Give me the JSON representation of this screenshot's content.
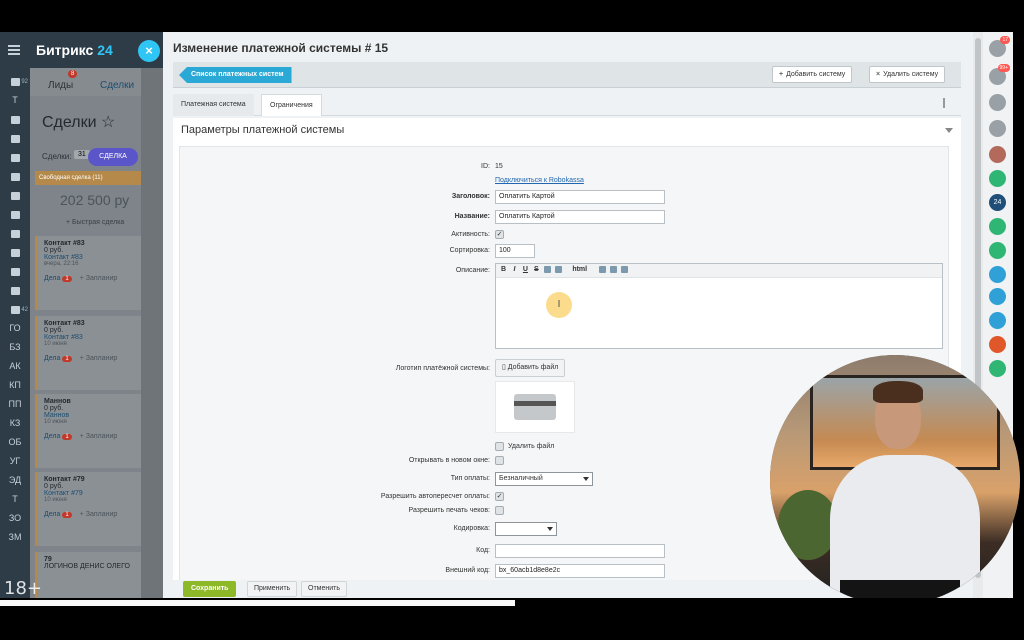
{
  "app": {
    "brand_name": "Битрикс",
    "brand_num": "24"
  },
  "leftnav": {
    "items": [
      {
        "label": "",
        "badge": "92"
      },
      {
        "label": "Т",
        "badge": ""
      },
      {
        "label": "",
        "badge": ""
      },
      {
        "label": "",
        "badge": ""
      },
      {
        "label": "",
        "badge": ""
      },
      {
        "label": "",
        "badge": ""
      },
      {
        "label": "",
        "badge": ""
      },
      {
        "label": "",
        "badge": ""
      },
      {
        "label": "",
        "badge": ""
      },
      {
        "label": "",
        "badge": ""
      },
      {
        "label": "",
        "badge": ""
      },
      {
        "label": "",
        "badge": ""
      },
      {
        "label": "",
        "badge": "42"
      },
      {
        "label": "ГО",
        "badge": ""
      },
      {
        "label": "БЗ",
        "badge": ""
      },
      {
        "label": "АК",
        "badge": ""
      },
      {
        "label": "КП",
        "badge": ""
      },
      {
        "label": "ПП",
        "badge": ""
      },
      {
        "label": "КЗ",
        "badge": ""
      },
      {
        "label": "ОБ",
        "badge": ""
      },
      {
        "label": "УГ",
        "badge": ""
      },
      {
        "label": "ЭД",
        "badge": ""
      },
      {
        "label": "Т",
        "badge": ""
      },
      {
        "label": "ЗО",
        "badge": ""
      },
      {
        "label": "ЗМ",
        "badge": ""
      }
    ]
  },
  "crm": {
    "tab_leads": "Лиды",
    "tab_leads_badge": "8",
    "tab_deals": "Сделки",
    "title": "Сделки ☆",
    "deals_label": "Сделки:",
    "deals_count": "31",
    "deal_button": "СДЕЛКА",
    "stage": "Свободная сделка (11)",
    "sum": "202 500 ру",
    "quick": "+ Быстрая сделка",
    "cards": [
      {
        "title": "Контакт #83",
        "price": "0 руб.",
        "link": "Контакт #83",
        "date": "вчера, 22:16",
        "deal": "Дела",
        "badge": "1",
        "plan": "+ Запланир"
      },
      {
        "title": "Контакт #83",
        "price": "0 руб.",
        "link": "Контакт #83",
        "date": "10 июня",
        "deal": "Дела",
        "badge": "1",
        "plan": "+ Запланир"
      },
      {
        "title": "Маннов",
        "price": "0 руб.",
        "link": "Маннов",
        "date": "10 июня",
        "deal": "Дела",
        "badge": "1",
        "plan": "+ Запланир"
      },
      {
        "title": "Контакт #79",
        "price": "0 руб.",
        "link": "Контакт #79",
        "date": "10 июня",
        "deal": "Дела",
        "badge": "1",
        "plan": "+ Запланир"
      },
      {
        "title": "79",
        "price": "ЛОГИНОВ ДЕНИС ОЛЕГО",
        "link": "",
        "date": "",
        "deal": "",
        "badge": "",
        "plan": ""
      }
    ]
  },
  "slider": {
    "title": "Изменение платежной системы # 15",
    "back_button": "Список платежных систем",
    "add_button": "Добавить систему",
    "delete_button": "Удалить систему",
    "tabs": [
      "Платежная система",
      "Ограничения"
    ],
    "section_title": "Параметры платежной системы",
    "fields": {
      "id_label": "ID:",
      "id_value": "15",
      "robokassa_link": "Подключиться к Robokassa",
      "header_label": "Заголовок:",
      "header_value": "Оплатить Картой",
      "name_label": "Название:",
      "name_value": "Оплатить Картой",
      "active_label": "Активность:",
      "sort_label": "Сортировка:",
      "sort_value": "100",
      "desc_label": "Описание:",
      "editor_buttons": [
        "B",
        "I",
        "U",
        "S",
        "html"
      ],
      "logo_label": "Логотип платёжной системы:",
      "add_file_button": "Добавить файл",
      "delete_file_label": "Удалить файл",
      "new_window_label": "Открывать в новом окне:",
      "pay_type_label": "Тип оплаты:",
      "pay_type_value": "Безналичный",
      "auto_recalc_label": "Разрешить автопересчет оплаты:",
      "print_check_label": "Разрешить печать чеков:",
      "encoding_label": "Кодировка:",
      "encoding_value": "",
      "code_label": "Код:",
      "code_value": "",
      "ext_code_label": "Внешний код:",
      "ext_code_value": "bx_60acb1d8e8e2c"
    },
    "footer": {
      "save": "Сохранить",
      "apply": "Применить",
      "cancel": "Отменить"
    }
  },
  "rightrail": {
    "items": [
      {
        "name": "help",
        "badge": "17",
        "color": "#9aa1a6"
      },
      {
        "name": "notifications",
        "badge": "99+",
        "color": "#9aa1a6"
      },
      {
        "name": "chat",
        "badge": "",
        "color": "#9aa1a6"
      },
      {
        "name": "search",
        "badge": "",
        "color": "#9aa1a6"
      },
      {
        "name": "user",
        "badge": "",
        "color": "#b36a5a"
      },
      {
        "name": "contact",
        "badge": "",
        "color": "#2fb574"
      },
      {
        "name": "b24",
        "badge": "",
        "color": "#1f4e79",
        "text": "24"
      },
      {
        "name": "contact2",
        "badge": "",
        "color": "#2fb574"
      },
      {
        "name": "phone",
        "badge": "",
        "color": "#2fb574"
      },
      {
        "name": "group1",
        "badge": "",
        "color": "#2fa1d6"
      },
      {
        "name": "group2",
        "badge": "",
        "color": "#2fa1d6"
      },
      {
        "name": "group3",
        "badge": "",
        "color": "#2fa1d6"
      },
      {
        "name": "red-contact",
        "badge": "",
        "color": "#e0582a"
      },
      {
        "name": "contact3",
        "badge": "",
        "color": "#2fb574"
      }
    ]
  },
  "overlay": {
    "age_rating": "18+"
  },
  "colors": {
    "accent": "#2fc6f6",
    "save_green": "#8db827",
    "nav_dark": "#2d3c47",
    "back_blue": "#2aa9d6"
  }
}
